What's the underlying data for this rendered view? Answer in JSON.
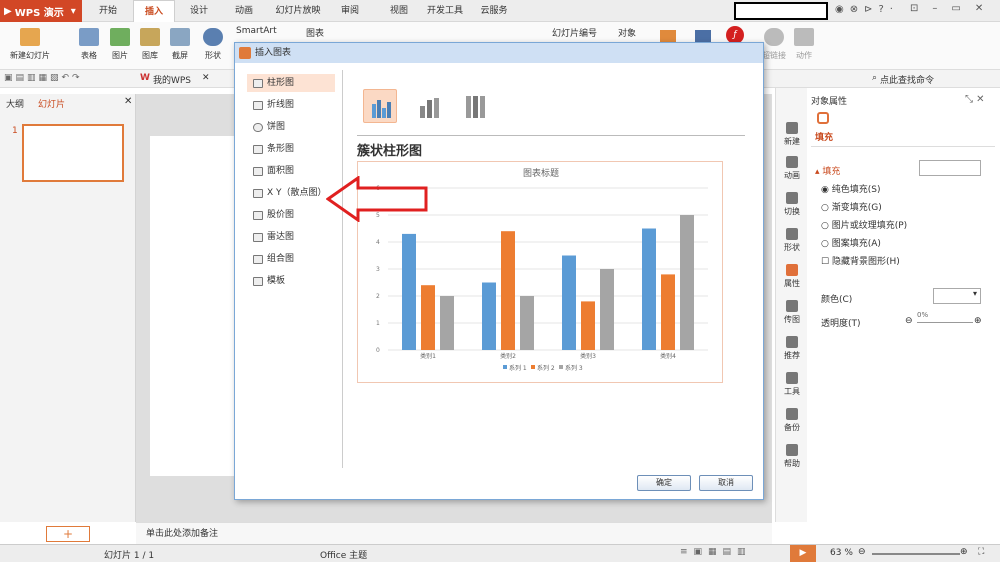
{
  "app": {
    "name": "WPS 演示"
  },
  "tabs": [
    "开始",
    "插入",
    "设计",
    "动画",
    "幻灯片放映",
    "审阅",
    "视图",
    "开发工具",
    "云服务"
  ],
  "active_tab": "插入",
  "ribbon": {
    "new_slide": "新建幻灯片",
    "table": "表格",
    "picture": "图片",
    "gallery": "图库",
    "screenshot": "截屏",
    "shape": "形状",
    "smartart": "SmartArt",
    "chart": "图表",
    "slide_number": "幻灯片编号",
    "object": "对象",
    "hyperlink": "超链接",
    "action": "动作"
  },
  "quickbar": {
    "mywps": "我的WPS",
    "search": "点此查找命令"
  },
  "left_pane": {
    "tab_outline": "大纲",
    "tab_slides": "幻灯片",
    "slide_number": "1"
  },
  "dialog": {
    "title": "插入图表",
    "chart_types": [
      "柱形图",
      "折线图",
      "饼图",
      "条形图",
      "面积图",
      "X Y（散点图）",
      "股价图",
      "雷达图",
      "组合图",
      "模板"
    ],
    "selected_type": "柱形图",
    "preview_name": "簇状柱形图",
    "ok": "确定",
    "cancel": "取消"
  },
  "chart_data": {
    "type": "bar",
    "title": "图表标题",
    "categories": [
      "类别1",
      "类别2",
      "类别3",
      "类别4"
    ],
    "series": [
      {
        "name": "系列 1",
        "values": [
          4.3,
          2.5,
          3.5,
          4.5
        ],
        "color": "#5b9bd5"
      },
      {
        "name": "系列 2",
        "values": [
          2.4,
          4.4,
          1.8,
          2.8
        ],
        "color": "#ed7d31"
      },
      {
        "name": "系列 3",
        "values": [
          2,
          2,
          3,
          5
        ],
        "color": "#a5a5a5"
      }
    ],
    "ylim": [
      0,
      6
    ],
    "yticks": [
      "0",
      "1",
      "2",
      "3",
      "4",
      "5",
      "6"
    ],
    "grid": true,
    "legend": "bottom"
  },
  "side_strip": [
    "新建",
    "动画",
    "切换",
    "形状",
    "属性",
    "传图",
    "推荐",
    "工具",
    "备份",
    "帮助"
  ],
  "props": {
    "header": "对象属性",
    "tab_fill": "填充",
    "section": "填充",
    "opt1": "纯色填充(S)",
    "opt2": "渐变填充(G)",
    "opt3": "图片或纹理填充(P)",
    "opt4": "图案填充(A)",
    "opt5": "隐藏背景图形(H)",
    "color_label": "颜色(C)",
    "transparency_label": "透明度(T)",
    "transparency_value": "0%"
  },
  "notes": "单击此处添加备注",
  "status": {
    "slide": "幻灯片 1 / 1",
    "theme": "Office 主题",
    "zoom": "63 %"
  },
  "accent": "#d24726",
  "arrow_color": "#e02020"
}
